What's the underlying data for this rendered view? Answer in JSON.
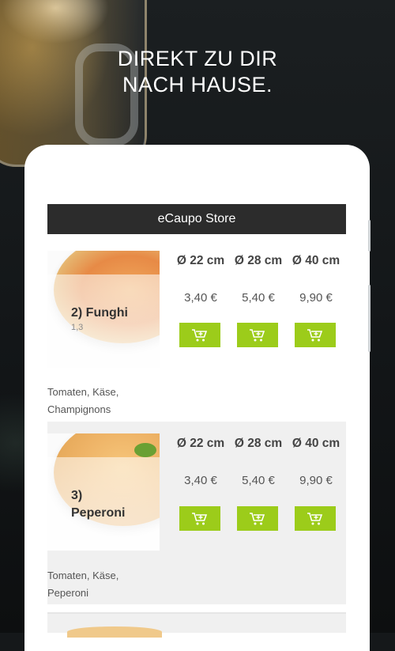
{
  "hero": {
    "line1": "DIREKT ZU DIR",
    "line2": "NACH HAUSE."
  },
  "store": {
    "title": "eCaupo Store"
  },
  "colors": {
    "accent": "#9ccc1a",
    "header": "#2c2c2c"
  },
  "products": [
    {
      "name": "2) Funghi",
      "code": "1,3",
      "sizes": [
        "Ø 22 cm",
        "Ø 28 cm",
        "Ø 40 cm"
      ],
      "prices": [
        "3,40 €",
        "5,40 €",
        "9,90 €"
      ],
      "desc_line1": "Tomaten, Käse,",
      "desc_line2": "Champignons",
      "icon": "add-to-cart-icon"
    },
    {
      "name_line1": "3)",
      "name_line2": "Peperoni",
      "sizes": [
        "Ø 22 cm",
        "Ø 28 cm",
        "Ø 40 cm"
      ],
      "prices": [
        "3,40 €",
        "5,40 €",
        "9,90 €"
      ],
      "desc_line1": "Tomaten, Käse,",
      "desc_line2": "Peperoni",
      "icon": "add-to-cart-icon"
    }
  ]
}
